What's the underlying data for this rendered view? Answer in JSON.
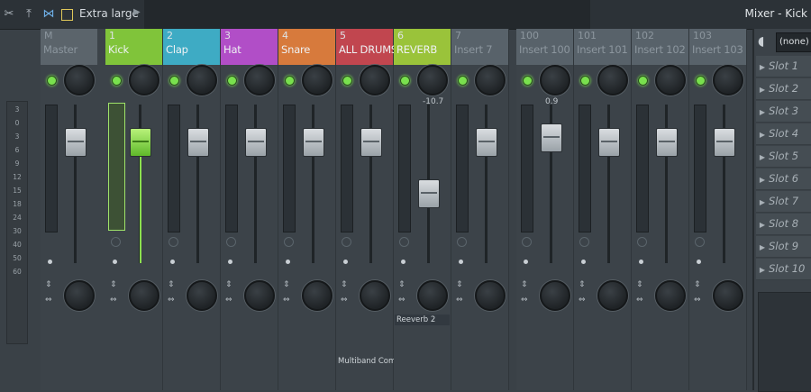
{
  "toolbar": {
    "preset_label": "Extra large",
    "window_title": "Mixer - Kick",
    "icons": [
      "cut-icon",
      "pin-icon",
      "bowtie-icon",
      "layout-icon",
      "chevron-right-icon"
    ]
  },
  "scale_labels": [
    "3",
    "0",
    "3",
    "6",
    "9",
    "12",
    "15",
    "18",
    "24",
    "30",
    "40",
    "50",
    "60"
  ],
  "strips": [
    {
      "num": "M",
      "name": "Master",
      "color": "#5b646b",
      "dim": true
    },
    {
      "num": "1",
      "name": "Kick",
      "color": "#80c43a",
      "selected": true
    },
    {
      "num": "2",
      "name": "Clap",
      "color": "#3eabc4"
    },
    {
      "num": "3",
      "name": "Hat",
      "color": "#b14ec7"
    },
    {
      "num": "4",
      "name": "Snare",
      "color": "#d77a3c"
    },
    {
      "num": "5",
      "name": "ALL DRUMS",
      "color": "#c1464f"
    },
    {
      "num": "6",
      "name": "REVERB",
      "color": "#9ac33a",
      "value": "-10.7"
    },
    {
      "num": "7",
      "name": "Insert 7",
      "color": "#58626a",
      "dim": true
    },
    {
      "num": "100",
      "name": "Insert 100",
      "color": "#58626a",
      "dim": true,
      "value": "0.9"
    },
    {
      "num": "101",
      "name": "Insert 101",
      "color": "#58626a",
      "dim": true
    },
    {
      "num": "102",
      "name": "Insert 102",
      "color": "#58626a",
      "dim": true
    },
    {
      "num": "103",
      "name": "Insert 103",
      "color": "#58626a",
      "dim": true
    }
  ],
  "effects": {
    "reverb": "Reeverb 2",
    "all_drums": "Multiband Comp"
  },
  "right_panel": {
    "route_select": "(none)",
    "slots": [
      "Slot 1",
      "Slot 2",
      "Slot 3",
      "Slot 4",
      "Slot 5",
      "Slot 6",
      "Slot 7",
      "Slot 8",
      "Slot 9",
      "Slot 10"
    ]
  }
}
